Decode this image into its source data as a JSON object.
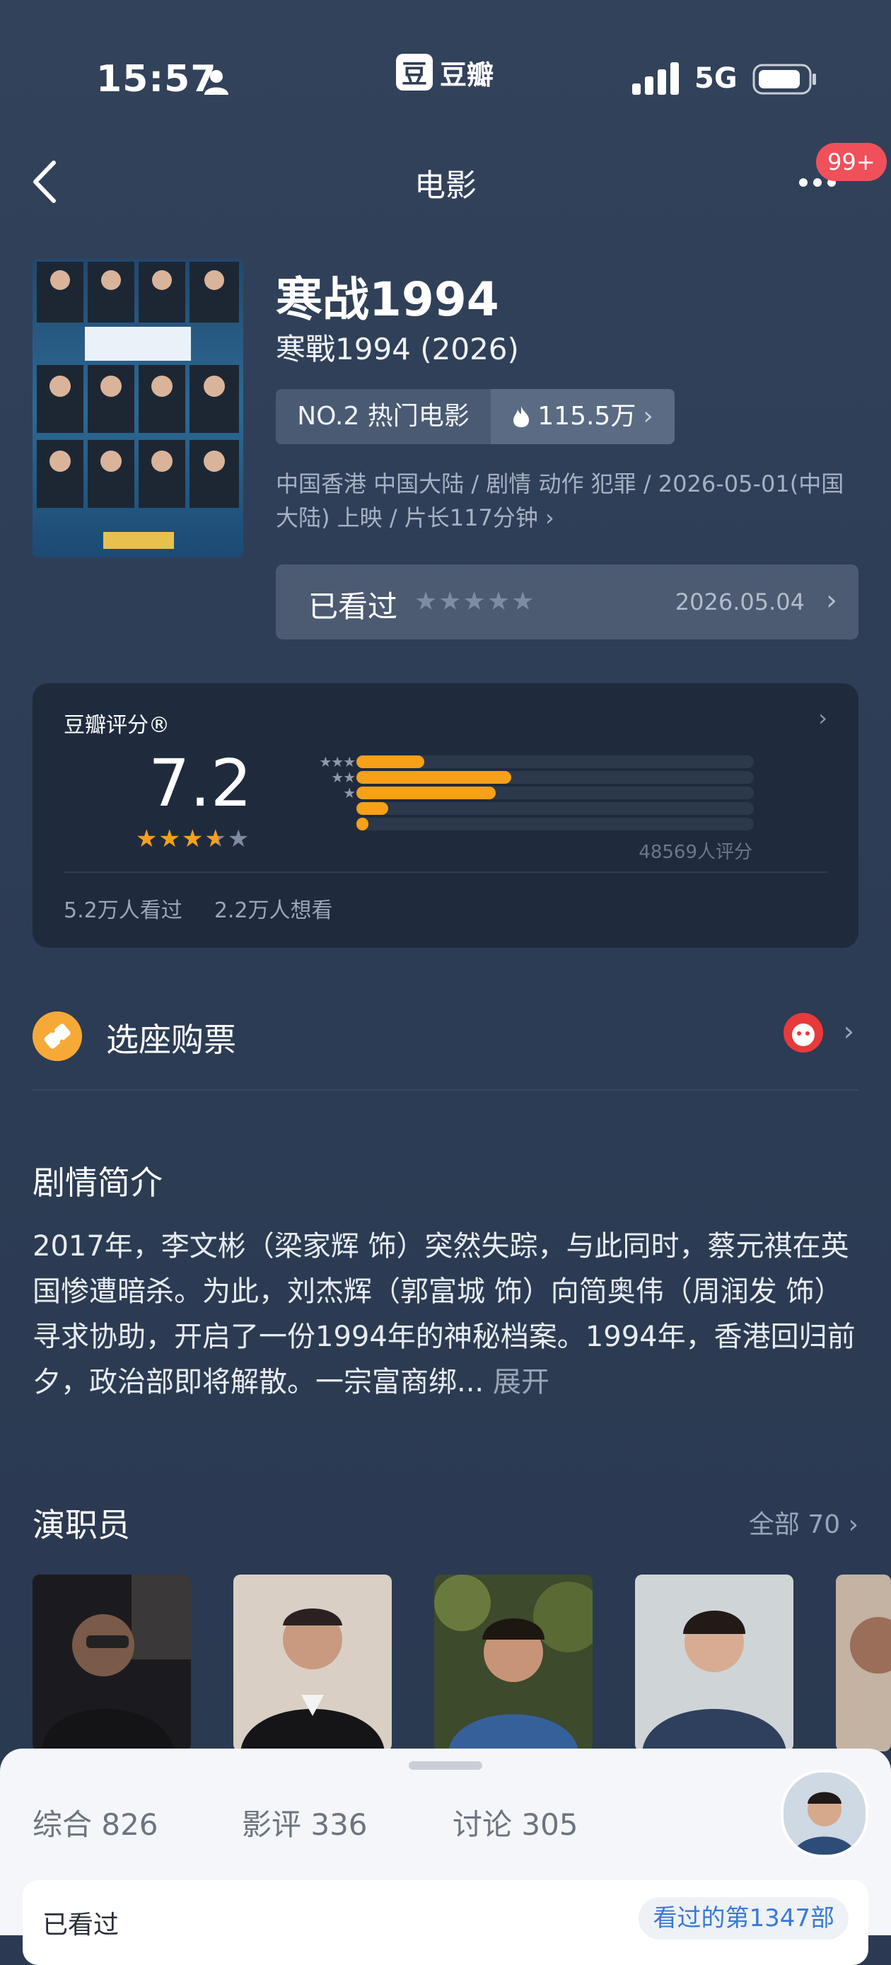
{
  "status_bar": {
    "time": "15:57",
    "app_name": "豆瓣",
    "app_logo_char": "豆",
    "network": "5G"
  },
  "nav": {
    "title": "电影",
    "badge": "99+"
  },
  "movie": {
    "title": "寒战1994",
    "subtitle": "寒戰1994 (2026)",
    "rank_label": "NO.2 热门电影",
    "hot_count": "115.5万",
    "meta": "中国香港 中国大陆 / 剧情 动作 犯罪 / 2026-05-01(中国大陆) 上映 / 片长117分钟",
    "watched_label": "已看过",
    "watched_stars": "★★★★★",
    "watched_date": "2026.05.04"
  },
  "rating": {
    "title": "豆瓣评分®",
    "score": "7.2",
    "stars": "★★★★★",
    "star_fill_fraction": 0.72,
    "distribution": [
      {
        "stars": 5,
        "label": "★★★★★",
        "fraction": 0.17
      },
      {
        "stars": 4,
        "label": "★★★★",
        "fraction": 0.39
      },
      {
        "stars": 3,
        "label": "★★★",
        "fraction": 0.35
      },
      {
        "stars": 2,
        "label": "★★",
        "fraction": 0.08
      },
      {
        "stars": 1,
        "label": "★",
        "fraction": 0.03
      }
    ],
    "vote_count": "48569人评分",
    "seen": "5.2万人看过",
    "want": "2.2万人想看"
  },
  "ticket": {
    "label": "选座购票"
  },
  "synopsis": {
    "heading": "剧情简介",
    "text": "2017年，李文彬（梁家辉 饰）突然失踪，与此同时，蔡元祺在英国惨遭暗杀。为此，刘杰辉（郭富城 饰）向简奥伟（周润发 饰）寻求协助，开启了一份1994年的神秘档案。1994年，香港回归前夕，政治部即将解散。一宗富商绑...",
    "expand": "展开"
  },
  "cast": {
    "heading": "演职员",
    "all_label": "全部 70"
  },
  "sheet": {
    "tabs": [
      "综合 826",
      "影评 336",
      "讨论 305"
    ],
    "card_label": "已看过",
    "card_pill": "看过的第1347部"
  },
  "colors": {
    "accent_orange": "#f7a018",
    "badge_red": "#f1505a",
    "background": "#2d3d55"
  }
}
